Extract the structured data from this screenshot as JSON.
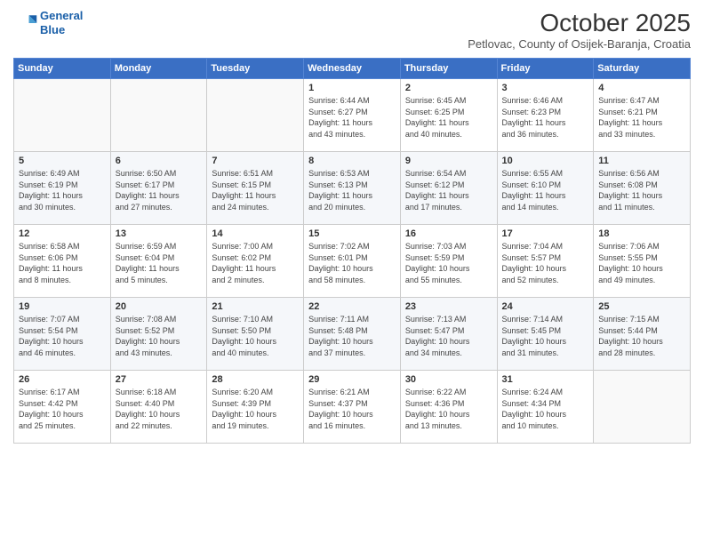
{
  "logo": {
    "line1": "General",
    "line2": "Blue"
  },
  "header": {
    "month_year": "October 2025",
    "location": "Petlovac, County of Osijek-Baranja, Croatia"
  },
  "days_of_week": [
    "Sunday",
    "Monday",
    "Tuesday",
    "Wednesday",
    "Thursday",
    "Friday",
    "Saturday"
  ],
  "weeks": [
    [
      {
        "day": "",
        "info": ""
      },
      {
        "day": "",
        "info": ""
      },
      {
        "day": "",
        "info": ""
      },
      {
        "day": "1",
        "info": "Sunrise: 6:44 AM\nSunset: 6:27 PM\nDaylight: 11 hours\nand 43 minutes."
      },
      {
        "day": "2",
        "info": "Sunrise: 6:45 AM\nSunset: 6:25 PM\nDaylight: 11 hours\nand 40 minutes."
      },
      {
        "day": "3",
        "info": "Sunrise: 6:46 AM\nSunset: 6:23 PM\nDaylight: 11 hours\nand 36 minutes."
      },
      {
        "day": "4",
        "info": "Sunrise: 6:47 AM\nSunset: 6:21 PM\nDaylight: 11 hours\nand 33 minutes."
      }
    ],
    [
      {
        "day": "5",
        "info": "Sunrise: 6:49 AM\nSunset: 6:19 PM\nDaylight: 11 hours\nand 30 minutes."
      },
      {
        "day": "6",
        "info": "Sunrise: 6:50 AM\nSunset: 6:17 PM\nDaylight: 11 hours\nand 27 minutes."
      },
      {
        "day": "7",
        "info": "Sunrise: 6:51 AM\nSunset: 6:15 PM\nDaylight: 11 hours\nand 24 minutes."
      },
      {
        "day": "8",
        "info": "Sunrise: 6:53 AM\nSunset: 6:13 PM\nDaylight: 11 hours\nand 20 minutes."
      },
      {
        "day": "9",
        "info": "Sunrise: 6:54 AM\nSunset: 6:12 PM\nDaylight: 11 hours\nand 17 minutes."
      },
      {
        "day": "10",
        "info": "Sunrise: 6:55 AM\nSunset: 6:10 PM\nDaylight: 11 hours\nand 14 minutes."
      },
      {
        "day": "11",
        "info": "Sunrise: 6:56 AM\nSunset: 6:08 PM\nDaylight: 11 hours\nand 11 minutes."
      }
    ],
    [
      {
        "day": "12",
        "info": "Sunrise: 6:58 AM\nSunset: 6:06 PM\nDaylight: 11 hours\nand 8 minutes."
      },
      {
        "day": "13",
        "info": "Sunrise: 6:59 AM\nSunset: 6:04 PM\nDaylight: 11 hours\nand 5 minutes."
      },
      {
        "day": "14",
        "info": "Sunrise: 7:00 AM\nSunset: 6:02 PM\nDaylight: 11 hours\nand 2 minutes."
      },
      {
        "day": "15",
        "info": "Sunrise: 7:02 AM\nSunset: 6:01 PM\nDaylight: 10 hours\nand 58 minutes."
      },
      {
        "day": "16",
        "info": "Sunrise: 7:03 AM\nSunset: 5:59 PM\nDaylight: 10 hours\nand 55 minutes."
      },
      {
        "day": "17",
        "info": "Sunrise: 7:04 AM\nSunset: 5:57 PM\nDaylight: 10 hours\nand 52 minutes."
      },
      {
        "day": "18",
        "info": "Sunrise: 7:06 AM\nSunset: 5:55 PM\nDaylight: 10 hours\nand 49 minutes."
      }
    ],
    [
      {
        "day": "19",
        "info": "Sunrise: 7:07 AM\nSunset: 5:54 PM\nDaylight: 10 hours\nand 46 minutes."
      },
      {
        "day": "20",
        "info": "Sunrise: 7:08 AM\nSunset: 5:52 PM\nDaylight: 10 hours\nand 43 minutes."
      },
      {
        "day": "21",
        "info": "Sunrise: 7:10 AM\nSunset: 5:50 PM\nDaylight: 10 hours\nand 40 minutes."
      },
      {
        "day": "22",
        "info": "Sunrise: 7:11 AM\nSunset: 5:48 PM\nDaylight: 10 hours\nand 37 minutes."
      },
      {
        "day": "23",
        "info": "Sunrise: 7:13 AM\nSunset: 5:47 PM\nDaylight: 10 hours\nand 34 minutes."
      },
      {
        "day": "24",
        "info": "Sunrise: 7:14 AM\nSunset: 5:45 PM\nDaylight: 10 hours\nand 31 minutes."
      },
      {
        "day": "25",
        "info": "Sunrise: 7:15 AM\nSunset: 5:44 PM\nDaylight: 10 hours\nand 28 minutes."
      }
    ],
    [
      {
        "day": "26",
        "info": "Sunrise: 6:17 AM\nSunset: 4:42 PM\nDaylight: 10 hours\nand 25 minutes."
      },
      {
        "day": "27",
        "info": "Sunrise: 6:18 AM\nSunset: 4:40 PM\nDaylight: 10 hours\nand 22 minutes."
      },
      {
        "day": "28",
        "info": "Sunrise: 6:20 AM\nSunset: 4:39 PM\nDaylight: 10 hours\nand 19 minutes."
      },
      {
        "day": "29",
        "info": "Sunrise: 6:21 AM\nSunset: 4:37 PM\nDaylight: 10 hours\nand 16 minutes."
      },
      {
        "day": "30",
        "info": "Sunrise: 6:22 AM\nSunset: 4:36 PM\nDaylight: 10 hours\nand 13 minutes."
      },
      {
        "day": "31",
        "info": "Sunrise: 6:24 AM\nSunset: 4:34 PM\nDaylight: 10 hours\nand 10 minutes."
      },
      {
        "day": "",
        "info": ""
      }
    ]
  ]
}
